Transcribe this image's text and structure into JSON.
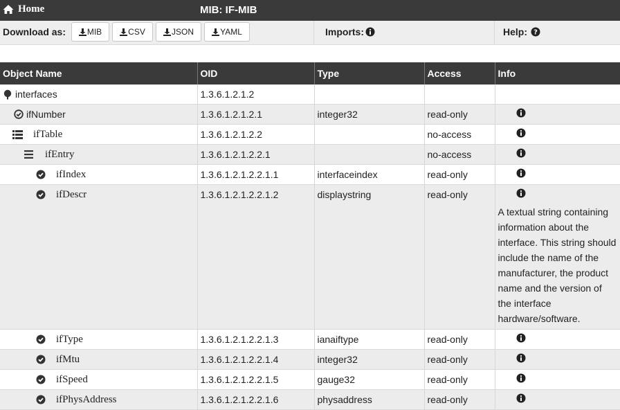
{
  "header": {
    "home_label": "Home",
    "title": "MIB: IF-MIB"
  },
  "download": {
    "label": "Download as:",
    "buttons": [
      "MIB",
      "CSV",
      "JSON",
      "YAML"
    ],
    "imports_label": "Imports:",
    "help_label": "Help:"
  },
  "table": {
    "columns": [
      "Object Name",
      "OID",
      "Type",
      "Access",
      "Info"
    ],
    "rows": [
      {
        "name": "interfaces",
        "oid": "1.3.6.1.2.1.2",
        "type": "",
        "access": "",
        "icon": "tree-icon",
        "info": false
      },
      {
        "name": "ifNumber",
        "oid": "1.3.6.1.2.1.2.1",
        "type": "integer32",
        "access": "read-only",
        "icon": "scalar-check-icon",
        "info": true
      },
      {
        "name": "ifTable",
        "oid": "1.3.6.1.2.1.2.2",
        "type": "",
        "access": "no-access",
        "icon": "table-list-icon",
        "info": true
      },
      {
        "name": "ifEntry",
        "oid": "1.3.6.1.2.1.2.2.1",
        "type": "",
        "access": "no-access",
        "icon": "entry-lines-icon",
        "info": true
      },
      {
        "name": "ifIndex",
        "oid": "1.3.6.1.2.1.2.2.1.1",
        "type": "interfaceindex",
        "access": "read-only",
        "icon": "column-check-icon",
        "info": true
      },
      {
        "name": "ifDescr",
        "oid": "1.3.6.1.2.1.2.2.1.2",
        "type": "displaystring",
        "access": "read-only",
        "icon": "column-check-icon",
        "info": true,
        "description": "A textual string containing information about the interface. This string should include the name of the manufacturer, the product name and the version of the interface hardware/software."
      },
      {
        "name": "ifType",
        "oid": "1.3.6.1.2.1.2.2.1.3",
        "type": "ianaiftype",
        "access": "read-only",
        "icon": "column-check-icon",
        "info": true
      },
      {
        "name": "ifMtu",
        "oid": "1.3.6.1.2.1.2.2.1.4",
        "type": "integer32",
        "access": "read-only",
        "icon": "column-check-icon",
        "info": true
      },
      {
        "name": "ifSpeed",
        "oid": "1.3.6.1.2.1.2.2.1.5",
        "type": "gauge32",
        "access": "read-only",
        "icon": "column-check-icon",
        "info": true
      },
      {
        "name": "ifPhysAddress",
        "oid": "1.3.6.1.2.1.2.2.1.6",
        "type": "physaddress",
        "access": "read-only",
        "icon": "column-check-icon",
        "info": true
      }
    ]
  },
  "colors": {
    "header_bg": "#3a3a3a",
    "stripe": "#ececec",
    "toolbar_bg": "#eeeeee"
  }
}
